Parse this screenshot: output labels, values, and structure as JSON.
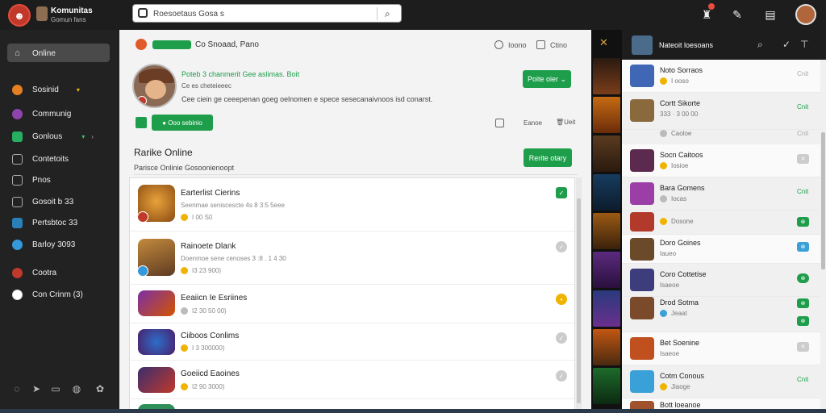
{
  "app": {
    "brand_title": "Komunitas",
    "brand_sub": "Gomun fans",
    "search_placeholder": "Roesoetaus Gosa s"
  },
  "sidebar": {
    "items": [
      {
        "label": "Online",
        "tail": ""
      },
      {
        "label": "Sosinid",
        "tail": "▾"
      },
      {
        "label": "Communig",
        "tail": ""
      },
      {
        "label": "Gonlous",
        "tail": "▾"
      },
      {
        "label": "Contetoits",
        "tail": ""
      },
      {
        "label": "Pnos",
        "tail": ""
      },
      {
        "label": "Gosoit b 33",
        "tail": ""
      },
      {
        "label": "Pertsbtoc 33",
        "tail": ""
      },
      {
        "label": "Barloy 3093",
        "tail": ""
      },
      {
        "label": "Cootra",
        "tail": ""
      },
      {
        "label": "Con Crinm (3)",
        "tail": ""
      }
    ]
  },
  "main": {
    "header": {
      "badge": "",
      "crumb": "Co Snoaad, Pano",
      "opt1": "Ioono",
      "opt2": "Ctino"
    },
    "profile": {
      "title": "Poteb 3 chanmerit Gee aslimas. Boit",
      "sub": "Ce es cheteieeec",
      "desc": "Cee ciein ge ceeepenan goeg oelnomen e spece sesecanaivnoos isd conarst.",
      "follow_label": "Poite oier",
      "add_label": "Ooo sebinio",
      "opt_a": "Eanoe",
      "opt_b": "Ueit"
    },
    "section": {
      "title": "Rarike Online",
      "sub": "Parisce Onlinie Gosoonienoopt",
      "btn_label": "Rerite otary"
    },
    "rows": [
      {
        "title": "Earterlist Cierins",
        "sub": "Seenmae seniscescte 4s 8 3:5 5eee",
        "meta": "I 00 S0"
      },
      {
        "title": "Rainoete Dlank",
        "sub": "Doenmoe sene cenoses 3 :8 . 1 4 30",
        "meta": "I3 23 900)"
      },
      {
        "title": "Eeaiicn Ie Esriines",
        "sub": "",
        "meta": "I2 30 50 00)"
      },
      {
        "title": "Ciiboos Conlims",
        "sub": "",
        "meta": "I 3 300000)"
      },
      {
        "title": "Goeiicd Eaoines",
        "sub": "",
        "meta": "I2 90 3000)"
      }
    ]
  },
  "rpanel": {
    "title": "Nateoit loesoans",
    "rows": [
      {
        "name": "Noto Sorraos",
        "meta": "I ooso",
        "status": "Cnit",
        "badge": ""
      },
      {
        "name": "Cortt Sikorte",
        "meta": "333 · 3 00 00",
        "status": "Cnit",
        "badge": ""
      },
      {
        "name": "",
        "meta": "Caoloe",
        "status": "Cnit",
        "badge": ""
      },
      {
        "name": "Socn Caitoos",
        "meta": "Iosioe",
        "status": "",
        "badge": "✕"
      },
      {
        "name": "Bara Gomens",
        "meta": "Iocas",
        "status": "Cnit",
        "badge": ""
      },
      {
        "name": "",
        "meta": "Dosone",
        "status": "",
        "badge": "⊗"
      },
      {
        "name": "Doro Goines",
        "meta": "Iaueo",
        "status": "",
        "badge": "⊗"
      },
      {
        "name": "Coro Cottetise",
        "meta": "Isaeoe",
        "status": "",
        "badge": "⊗"
      },
      {
        "name": "Drod Sotma",
        "meta": "Jeaat",
        "status": "",
        "badge": "⊗"
      },
      {
        "name": "",
        "meta": "",
        "status": "",
        "badge": "⊗"
      },
      {
        "name": "Bet Soenine",
        "meta": "Isaeoe",
        "status": "",
        "badge": "✕"
      },
      {
        "name": "Cotm Conous",
        "meta": "Jiaoge",
        "status": "Cnit",
        "badge": ""
      },
      {
        "name": "Bott loeanoe",
        "meta": "",
        "status": "",
        "badge": ""
      }
    ]
  }
}
